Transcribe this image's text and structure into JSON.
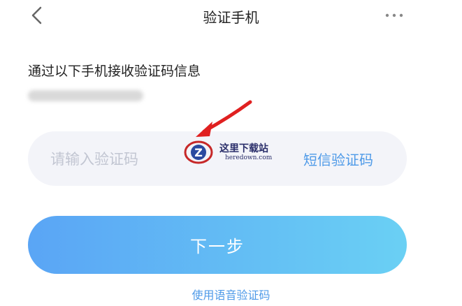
{
  "header": {
    "title": "验证手机"
  },
  "main": {
    "hint": "通过以下手机接收验证码信息",
    "phone_masked": "",
    "code_input": {
      "value": "",
      "placeholder": "请输入验证码"
    },
    "sms_button_label": "短信验证码",
    "next_button_label": "下一步",
    "voice_code_link": "使用语音验证码"
  },
  "watermark": {
    "name": "这里下载站",
    "url": "heredown.com"
  },
  "colors": {
    "accent": "#4e9ae8",
    "button_gradient_start": "#5aa5f5",
    "button_gradient_end": "#6ad0f4",
    "input_background": "#f3f4f9",
    "annotation_arrow": "#e02020"
  },
  "icons": {
    "back": "chevron-left-icon",
    "more": "more-dots-icon",
    "watermark_logo": "z-logo-icon",
    "annotation": "red-arrow-icon"
  }
}
